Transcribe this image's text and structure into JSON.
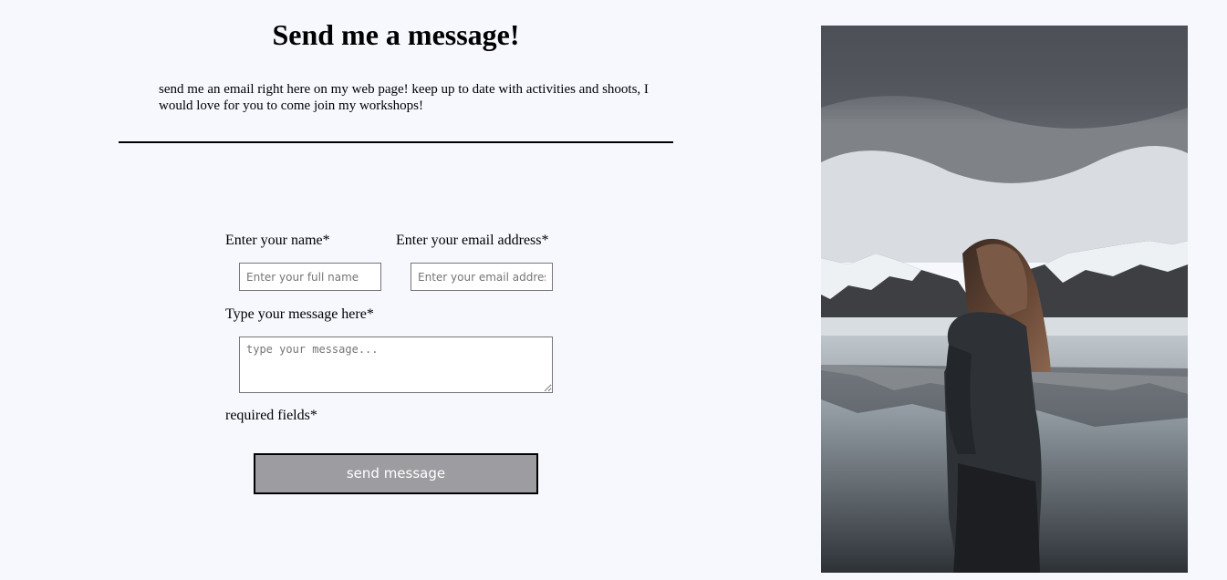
{
  "page": {
    "title": "Send me a message!",
    "intro": "send me an email right here on my web page! keep up to date with activities and shoots, I would love for you to come join my workshops!"
  },
  "form": {
    "name_label": "Enter your name*",
    "name_placeholder": "Enter your full name",
    "email_label": "Enter your email address*",
    "email_placeholder": "Enter your email address",
    "message_label": "Type your message here*",
    "message_placeholder": "type your message...",
    "required_note": "required fields*",
    "submit_label": "send message"
  },
  "photo": {
    "subject": "woman-by-mountain-lake"
  },
  "colors": {
    "page_background": "#f7f8fe",
    "button_background": "#9d9da1",
    "button_text": "#ffffff"
  }
}
